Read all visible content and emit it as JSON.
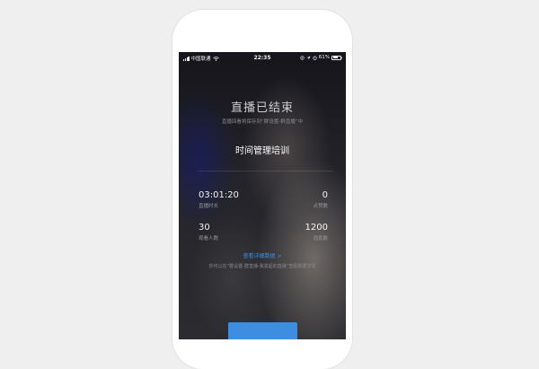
{
  "status_bar": {
    "carrier": "中国联通",
    "time": "22:35",
    "battery": "61%",
    "battery_level": 0.61
  },
  "live_end": {
    "title": "直播已结束",
    "subtitle": "直播回看将保存到“群设置-群直播”中",
    "course_name": "时间管理培训"
  },
  "stats": [
    {
      "value": "03:01:20",
      "label": "直播时长"
    },
    {
      "value": "0",
      "label": "点赞数"
    },
    {
      "value": "30",
      "label": "观看人数"
    },
    {
      "value": "1200",
      "label": "消息数"
    }
  ],
  "detail_link": "查看详细数据 >",
  "hint": "你可以在“群设置-群直播-我发起的直播”查看数据详情",
  "colors": {
    "accent": "#3d8ee0",
    "link": "#3f8fe0",
    "page_background": "#efefef"
  },
  "icons": {
    "signal": "signal-bars-icon",
    "wifi": "wifi-icon",
    "location": "location-icon",
    "navigation": "navigation-arrow-icon",
    "alarm": "alarm-icon",
    "battery": "battery-icon"
  }
}
